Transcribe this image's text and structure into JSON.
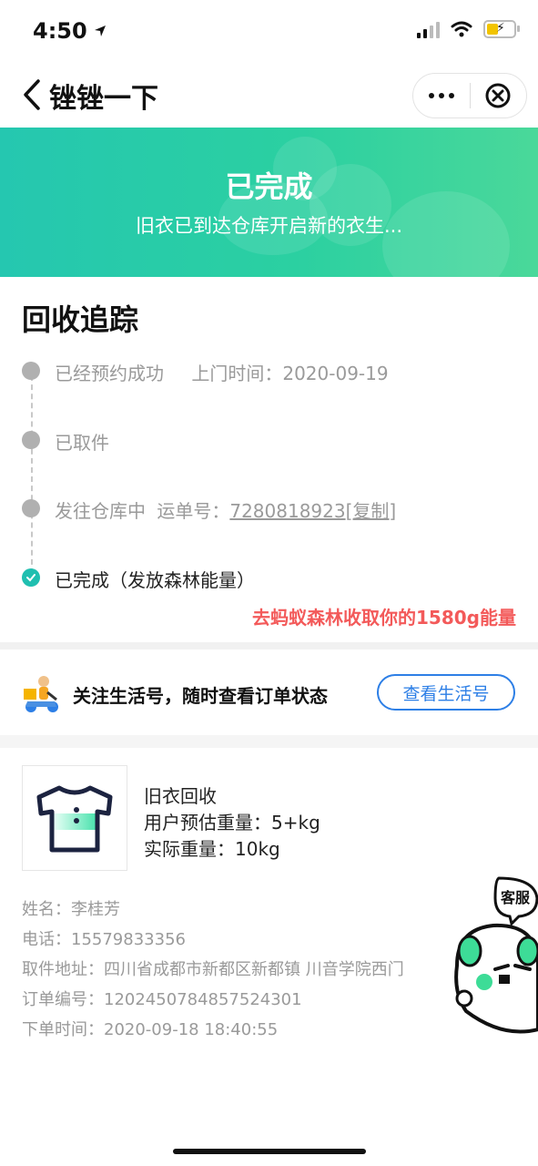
{
  "status_bar": {
    "time": "4:50"
  },
  "nav": {
    "title": "锉锉一下",
    "back_icon": "chevron-left-icon",
    "more_icon": "more-dots-icon",
    "close_icon": "close-circle-icon"
  },
  "banner": {
    "title": "已完成",
    "subtitle": "旧衣已到达仓库开启新的衣生..."
  },
  "tracking": {
    "title": "回收追踪",
    "steps": [
      {
        "label": "已经预约成功",
        "extra_label": "上门时间：",
        "extra_value": "2020-09-19"
      },
      {
        "label": "已取件"
      },
      {
        "label": "发往仓库中",
        "extra_label": "运单号：",
        "tracking_no": "7280818923",
        "copy_label": "[复制]"
      },
      {
        "label": "已完成（发放森林能量）"
      }
    ],
    "energy_link": "去蚂蚁森林收取你的1580g能量"
  },
  "follow": {
    "text": "关注生活号，随时查看订单状态",
    "button": "查看生活号",
    "icon": "scooter-courier-icon"
  },
  "product": {
    "name": "旧衣回收",
    "estimated_weight": "用户预估重量：5+kg",
    "actual_weight": "实际重量：10kg",
    "icon": "tshirt-icon"
  },
  "order": {
    "name_label": "姓名：",
    "name": "李桂芳",
    "phone_label": "电话：",
    "phone": "15579833356",
    "address_label": "取件地址：",
    "address": "四川省成都市新都区新都镇 川音学院西门",
    "order_no_label": "订单编号：",
    "order_no": "1202450784857524301",
    "order_time_label": "下单时间：",
    "order_time": "2020-09-18 18:40:55"
  },
  "customer_service": {
    "label": "客服",
    "icon": "mascot-cat-icon"
  },
  "colors": {
    "banner_start": "#25c7b0",
    "banner_end": "#4ad89a",
    "accent_blue": "#2d7fe6",
    "energy_red": "#f35a5a",
    "done_teal": "#1fbfb0"
  }
}
